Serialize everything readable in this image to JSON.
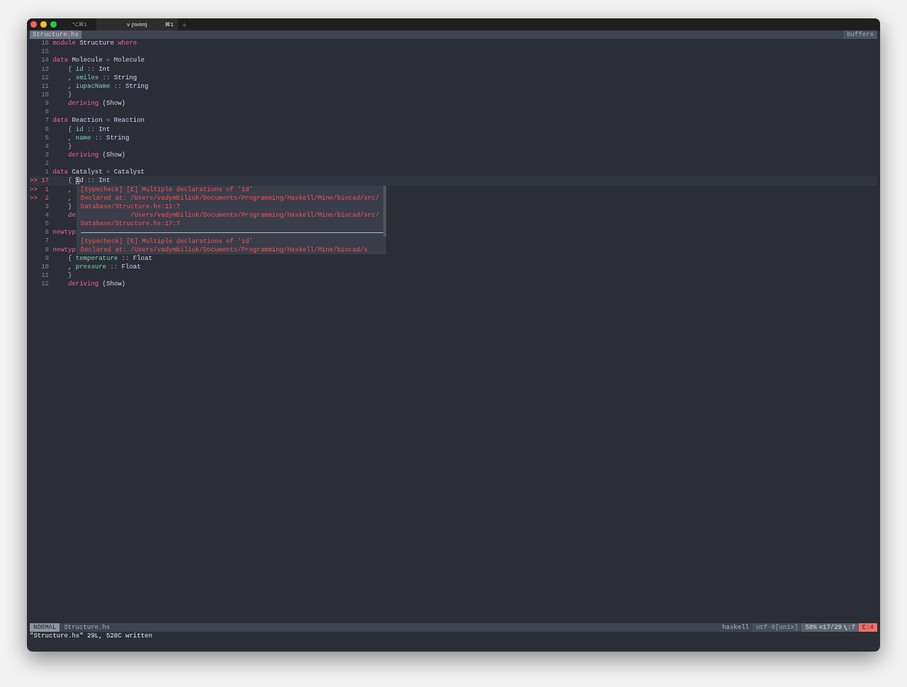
{
  "titlebar": {
    "tabs": [
      {
        "shortcut": "⌥⌘1",
        "selected": false
      },
      {
        "title": "v (nvim)",
        "shortcut": "⌘1",
        "selected": true
      }
    ],
    "new_tab": "+"
  },
  "tabline": {
    "buffers": [
      {
        "name": "Structure.hs",
        "selected": true
      }
    ],
    "label": "buffers"
  },
  "editor": {
    "lines": [
      {
        "number": "16",
        "tokens": [
          {
            "kind": "kw",
            "text": "module"
          },
          {
            "kind": "type",
            "text": " Structure"
          },
          {
            "kind": "kw",
            "text": " where"
          }
        ]
      },
      {
        "number": "15"
      },
      {
        "number": "14",
        "tokens": [
          {
            "kind": "kw",
            "text": "data"
          },
          {
            "kind": "type",
            "text": " Molecule"
          },
          {
            "kind": "op",
            "text": " ="
          },
          {
            "kind": "type",
            "text": " Molecule"
          }
        ]
      },
      {
        "number": "13",
        "tokens": [
          {
            "kind": "punct",
            "text": "    {"
          },
          {
            "kind": "field",
            "text": " id"
          },
          {
            "kind": "op",
            "text": " ::"
          },
          {
            "kind": "type",
            "text": " Int"
          }
        ]
      },
      {
        "number": "12",
        "tokens": [
          {
            "kind": "punct",
            "text": "    ,"
          },
          {
            "kind": "field",
            "text": " smiles"
          },
          {
            "kind": "op",
            "text": " ::"
          },
          {
            "kind": "type",
            "text": " String"
          }
        ]
      },
      {
        "number": "11",
        "tokens": [
          {
            "kind": "punct",
            "text": "    ,"
          },
          {
            "kind": "field",
            "text": " iupacName"
          },
          {
            "kind": "op",
            "text": " ::"
          },
          {
            "kind": "type",
            "text": " String"
          }
        ]
      },
      {
        "number": "10",
        "tokens": [
          {
            "kind": "punct",
            "text": "    }"
          }
        ]
      },
      {
        "number": "9",
        "tokens": [
          {
            "kind": "kw",
            "text": "    deriving"
          },
          {
            "kind": "type",
            "text": " (Show)"
          }
        ]
      },
      {
        "number": "8"
      },
      {
        "number": "7",
        "tokens": [
          {
            "kind": "kw",
            "text": "data"
          },
          {
            "kind": "type",
            "text": " Reaction"
          },
          {
            "kind": "op",
            "text": " ="
          },
          {
            "kind": "type",
            "text": " Reaction"
          }
        ]
      },
      {
        "number": "6",
        "tokens": [
          {
            "kind": "punct",
            "text": "    {"
          },
          {
            "kind": "field",
            "text": " id"
          },
          {
            "kind": "op",
            "text": " ::"
          },
          {
            "kind": "type",
            "text": " Int"
          }
        ]
      },
      {
        "number": "5",
        "tokens": [
          {
            "kind": "punct",
            "text": "    ,"
          },
          {
            "kind": "field",
            "text": " name"
          },
          {
            "kind": "op",
            "text": " ::"
          },
          {
            "kind": "type",
            "text": " String"
          }
        ]
      },
      {
        "number": "4",
        "tokens": [
          {
            "kind": "punct",
            "text": "    }"
          }
        ]
      },
      {
        "number": "3",
        "tokens": [
          {
            "kind": "kw",
            "text": "    deriving"
          },
          {
            "kind": "type",
            "text": " (Show)"
          }
        ]
      },
      {
        "number": "2"
      },
      {
        "number": "1",
        "tokens": [
          {
            "kind": "kw",
            "text": "data"
          },
          {
            "kind": "type",
            "text": " Catalyst"
          },
          {
            "kind": "op",
            "text": " ="
          },
          {
            "kind": "type",
            "text": " Catalyst"
          }
        ]
      },
      {
        "sign": ">>",
        "number": "17",
        "current": true,
        "tokens": [
          {
            "kind": "punct",
            "text": "    { "
          },
          {
            "kind": "cursor",
            "text": "i"
          },
          {
            "kind": "plain",
            "text": "d"
          },
          {
            "kind": "op",
            "text": " ::"
          },
          {
            "kind": "type",
            "text": " Int"
          }
        ]
      },
      {
        "sign": ">>",
        "number": "1",
        "tokens": [
          {
            "kind": "punct",
            "text": "    ,"
          }
        ]
      },
      {
        "sign": ">>",
        "number": "2",
        "tokens": [
          {
            "kind": "punct",
            "text": "    ,"
          }
        ]
      },
      {
        "number": "3",
        "tokens": [
          {
            "kind": "punct",
            "text": "    }"
          }
        ]
      },
      {
        "number": "4",
        "tokens": [
          {
            "kind": "kw",
            "text": "    de"
          }
        ]
      },
      {
        "number": "5"
      },
      {
        "number": "6",
        "tokens": [
          {
            "kind": "kw",
            "text": "newtyp"
          }
        ]
      },
      {
        "number": "7"
      },
      {
        "number": "8",
        "tokens": [
          {
            "kind": "kw",
            "text": "newtyp"
          }
        ]
      },
      {
        "number": "9",
        "tokens": [
          {
            "kind": "punct",
            "text": "    {"
          },
          {
            "kind": "field",
            "text": " temperature"
          },
          {
            "kind": "op",
            "text": " ::"
          },
          {
            "kind": "type",
            "text": " Float"
          }
        ]
      },
      {
        "number": "10",
        "tokens": [
          {
            "kind": "punct",
            "text": "    ,"
          },
          {
            "kind": "field",
            "text": " pressure"
          },
          {
            "kind": "op",
            "text": " ::"
          },
          {
            "kind": "type",
            "text": " Float"
          }
        ]
      },
      {
        "number": "11",
        "tokens": [
          {
            "kind": "punct",
            "text": "    }"
          }
        ]
      },
      {
        "number": "12",
        "tokens": [
          {
            "kind": "kw",
            "text": "    deriving"
          },
          {
            "kind": "type",
            "text": " (Show)"
          }
        ]
      }
    ],
    "popup": {
      "lines": [
        {
          "kind": "text",
          "text": "[typecheck] [E] Multiple declarations of 'id'"
        },
        {
          "kind": "text",
          "text": "Declared at: /Users/vadymbiliuk/Documents/Programming/Haskell/Mine/biocad/src/"
        },
        {
          "kind": "text",
          "text": "Database/Structure.hs:11:7"
        },
        {
          "kind": "text",
          "text": "             /Users/vadymbiliuk/Documents/Programming/Haskell/Mine/biocad/src/"
        },
        {
          "kind": "text",
          "text": "Database/Structure.hs:17:7"
        },
        {
          "kind": "separator"
        },
        {
          "kind": "text",
          "text": "[typecheck] [E] Multiple declarations of 'id'"
        },
        {
          "kind": "text",
          "text": "Declared at: /Users/vadymbiliuk/Documents/Programming/Haskell/Mine/biocad/s"
        }
      ]
    }
  },
  "status_bar": {
    "mode": "NORMAL",
    "file": "Structure.hs",
    "filetype": "haskell",
    "encoding": "utf-8[unix]",
    "percent": "58%",
    "line_icon": "≡",
    "position": "17/29",
    "column": ":7",
    "errors": "E:4"
  },
  "message": "\"Structure.hs\" 29L, 528C written"
}
